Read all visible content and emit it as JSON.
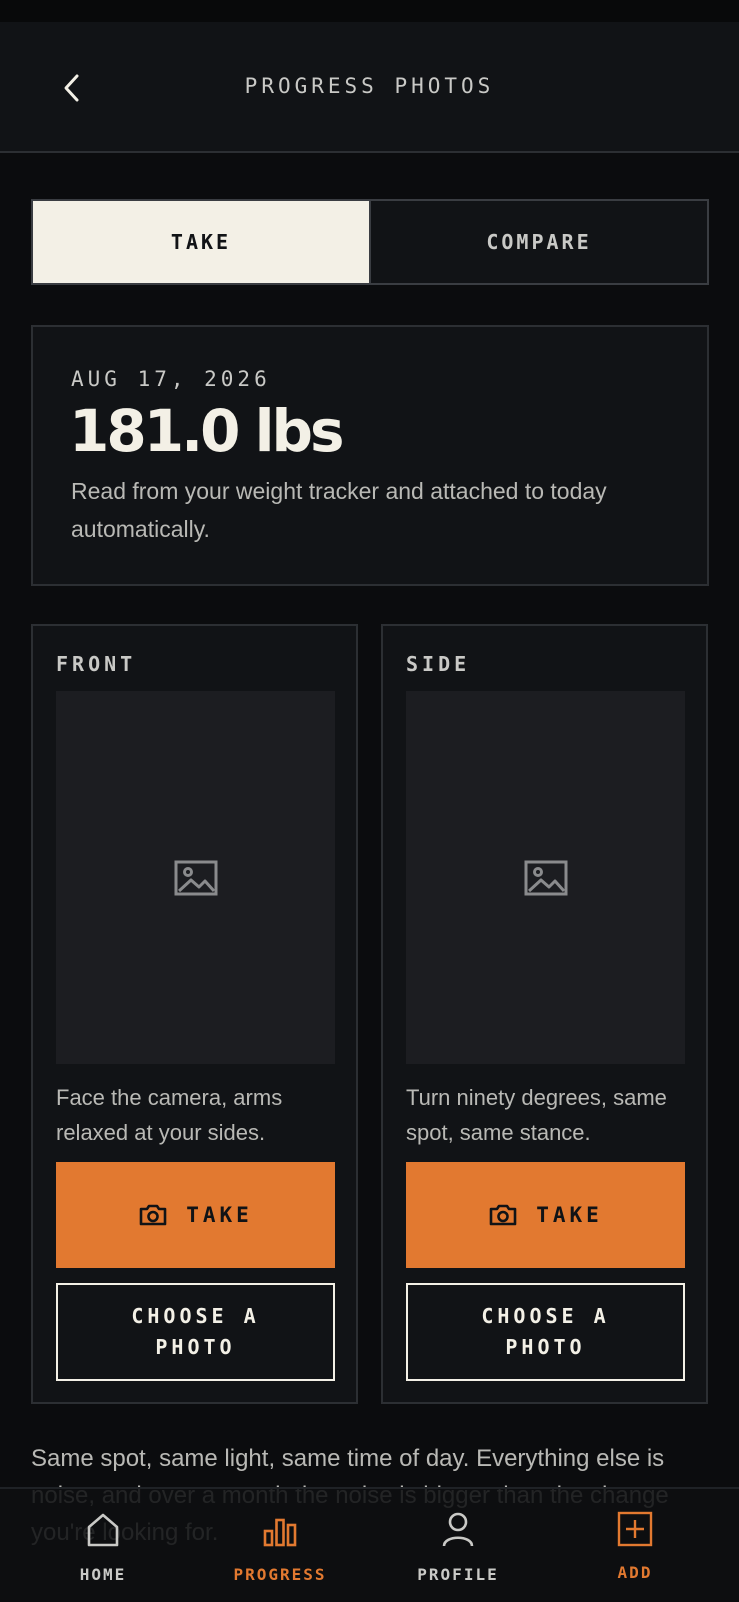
{
  "header": {
    "title": "PROGRESS PHOTOS"
  },
  "segment": {
    "take_label": "TAKE",
    "compare_label": "COMPARE"
  },
  "weight_card": {
    "date": "AUG 17, 2026",
    "weight": "181.0 lbs",
    "note": "Read from your weight tracker and attached to today automatically."
  },
  "photos": {
    "front": {
      "label": "FRONT",
      "instruction": "Face the camera, arms relaxed at your sides.",
      "take_label": "TAKE",
      "choose_label": "CHOOSE A PHOTO"
    },
    "side": {
      "label": "SIDE",
      "instruction": "Turn ninety degrees, same spot, same stance.",
      "take_label": "TAKE",
      "choose_label": "CHOOSE A PHOTO"
    }
  },
  "footer_note": "Same spot, same light, same time of day. Everything else is noise, and over a month the noise is bigger than the change you're looking for.",
  "tabbar": {
    "home": "HOME",
    "progress": "PROGRESS",
    "profile": "PROFILE",
    "add": "ADD"
  },
  "colors": {
    "accent": "#e27930",
    "background": "#0b0c0e",
    "card": "#111316",
    "cream": "#f3f0e6"
  },
  "icons": {
    "back": "chevron-left-icon",
    "placeholder": "image-icon",
    "camera": "camera-icon",
    "home": "home-icon",
    "progress": "bar-chart-icon",
    "profile": "person-icon",
    "add": "plus-square-icon"
  }
}
